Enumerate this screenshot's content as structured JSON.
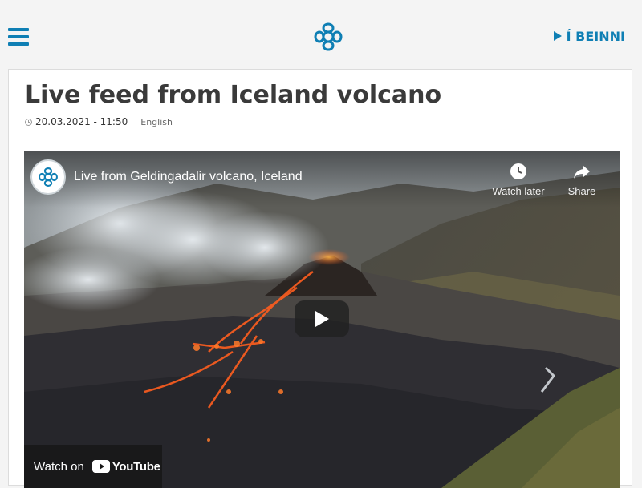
{
  "header": {
    "menu_icon": "hamburger-menu-icon",
    "logo_icon": "ruv-logo-icon",
    "live_link_label": "Í BEINNI",
    "accent_color": "#0f7fb4"
  },
  "article": {
    "title": "Live feed from Iceland volcano",
    "date": "20.03.2021 - 11:50",
    "language": "English"
  },
  "video": {
    "title": "Live from Geldingadalir volcano, Iceland",
    "watch_later_label": "Watch later",
    "share_label": "Share",
    "watch_on_label": "Watch on",
    "youtube_label": "YouTube"
  }
}
